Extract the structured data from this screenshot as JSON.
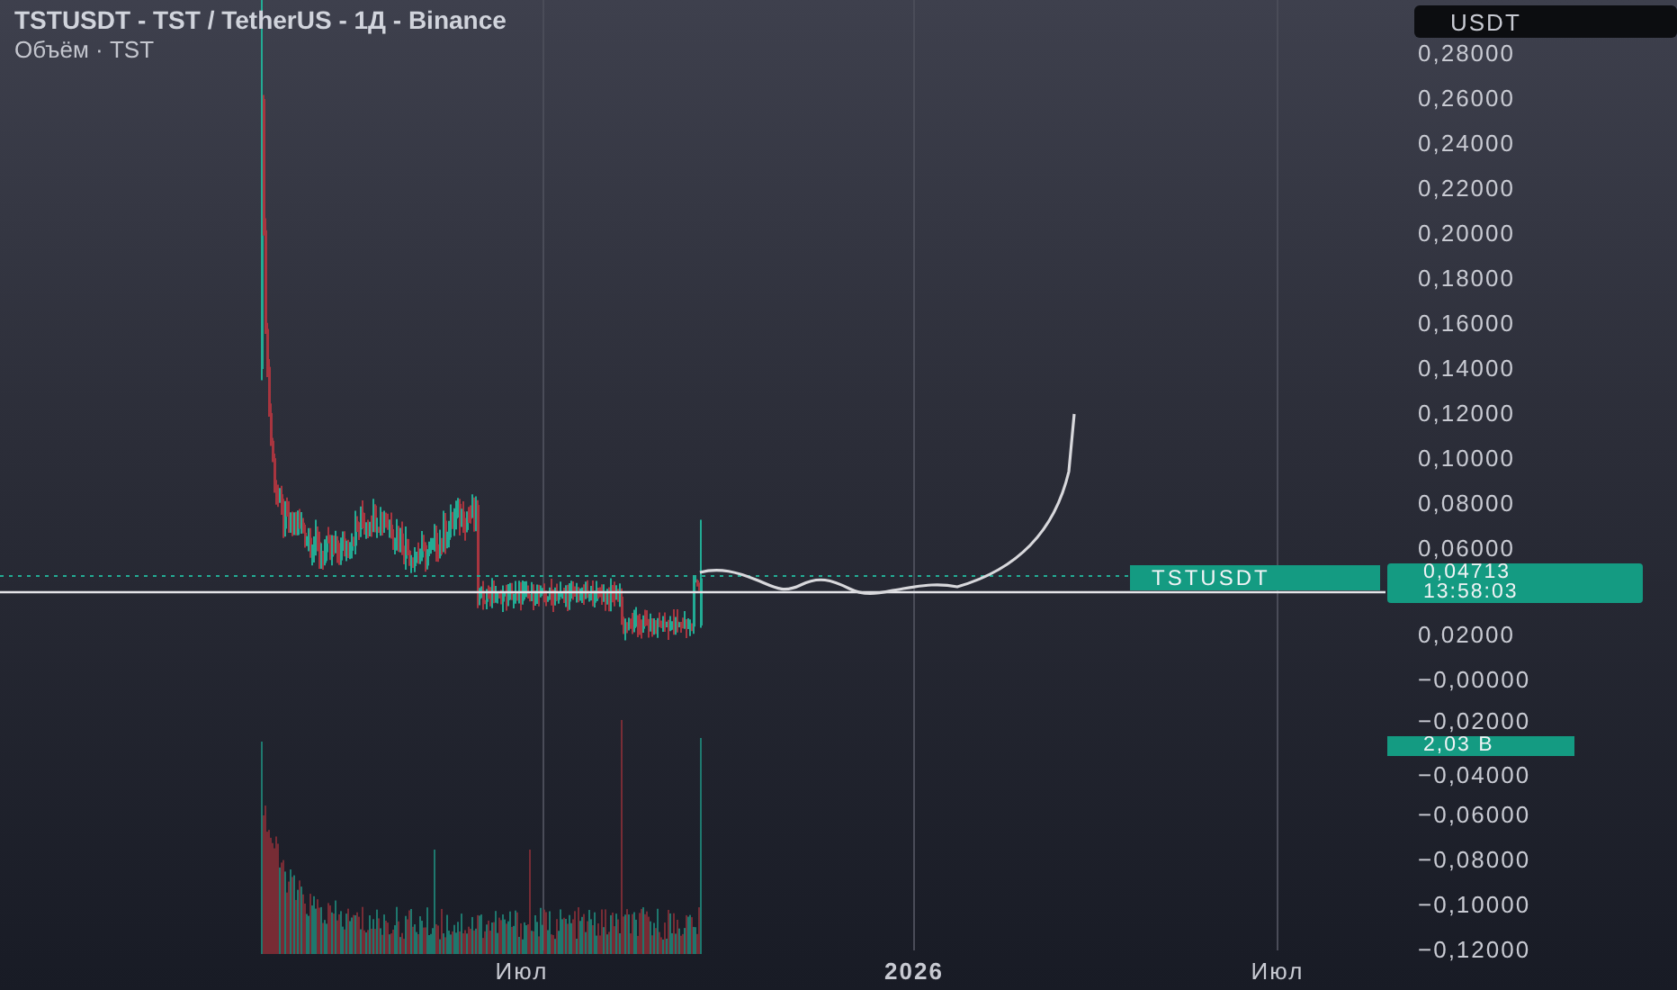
{
  "header": {
    "title": "TSTUSDT - TST / TetherUS - 1Д - Binance",
    "volume_legend": "Объём · TST"
  },
  "currency_button": "USDT",
  "price_axis": {
    "upper_ticks": [
      "0,28000",
      "0,26000",
      "0,24000",
      "0,22000",
      "0,20000",
      "0,18000",
      "0,16000",
      "0,14000",
      "0,12000",
      "0,10000",
      "0,08000",
      "0,06000"
    ],
    "lower_ticks": [
      "0,02000",
      "−0,00000",
      "−0,02000",
      "−0,04000",
      "−0,06000",
      "−0,08000",
      "−0,10000",
      "−0,12000"
    ]
  },
  "last_price": {
    "symbol": "TSTUSDT",
    "price": "0,04713",
    "countdown": "13:58:03"
  },
  "volume_badge": "2,03 B",
  "time_axis": [
    {
      "label": "Июл",
      "bold": false
    },
    {
      "label": "2026",
      "bold": true
    },
    {
      "label": "Июл",
      "bold": false
    }
  ]
}
